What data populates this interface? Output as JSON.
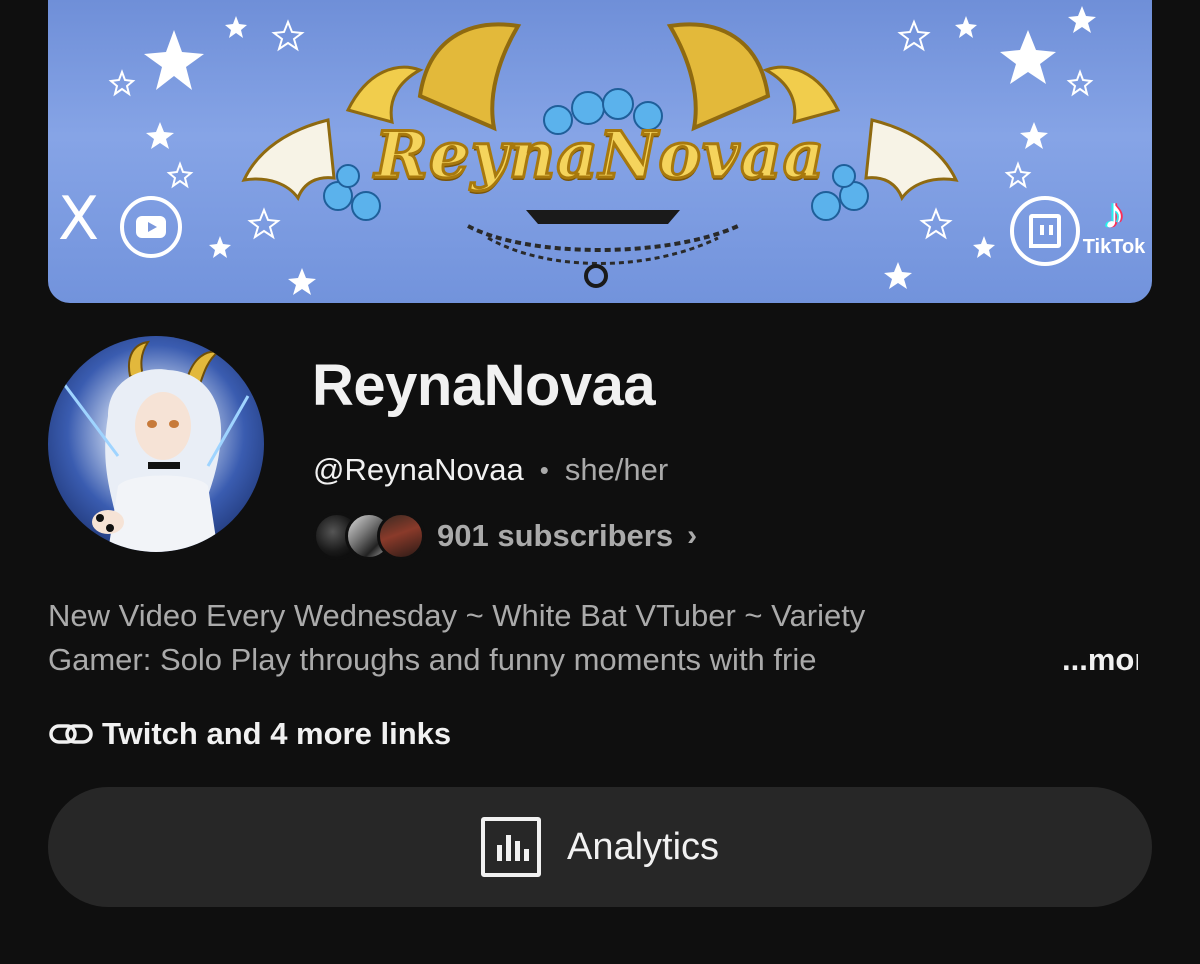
{
  "banner": {
    "title_art": "ReynaNovaa",
    "socials": [
      {
        "name": "x-icon",
        "glyph": "X"
      },
      {
        "name": "youtube-icon"
      },
      {
        "name": "twitch-icon"
      },
      {
        "name": "tiktok-icon",
        "label": "TikTok"
      }
    ]
  },
  "channel": {
    "name": "ReynaNovaa",
    "handle": "@ReynaNovaa",
    "separator": "•",
    "pronouns": "she/her",
    "subscribers": "901 subscribers",
    "chevron": "›"
  },
  "description": {
    "line1": "New Video Every Wednesday ~ White Bat VTuber ~ Variety",
    "line2": "Gamer: Solo Play throughs and funny moments with frie",
    "more_label": "...more"
  },
  "links": {
    "label": "Twitch and 4 more links"
  },
  "actions": {
    "analytics_label": "Analytics"
  },
  "colors": {
    "background": "#0f0f0f",
    "primary_text": "#f1f1f1",
    "secondary_text": "#aaaaaa",
    "button_bg": "#272727",
    "banner_blue": "#7b98dc",
    "banner_gold": "#f5d45c"
  }
}
